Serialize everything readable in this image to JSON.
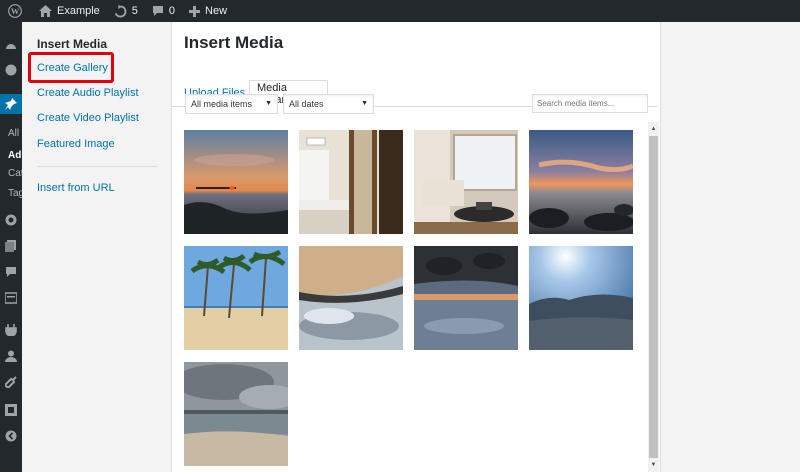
{
  "admin_bar": {
    "site_name": "Example",
    "updates_count": "5",
    "comments_count": "0",
    "new_label": "New"
  },
  "admin_menu": {
    "items": [
      "All",
      "Ad",
      "Cat",
      "Tag"
    ]
  },
  "media_menu": {
    "heading": "Insert Media",
    "items": [
      "Create Gallery",
      "Create Audio Playlist",
      "Create Video Playlist",
      "Featured Image"
    ],
    "insert_from_url": "Insert from URL"
  },
  "frame": {
    "title": "Insert Media",
    "tabs": [
      {
        "label": "Upload Files",
        "active": false
      },
      {
        "label": "Media Library",
        "active": true
      }
    ]
  },
  "toolbar": {
    "filter_type_selected": "All media items",
    "filter_date_selected": "All dates",
    "search_placeholder": "Search media items..."
  },
  "attachments": [
    {
      "icon": "sunset-pier-photo"
    },
    {
      "icon": "bedroom-photo"
    },
    {
      "icon": "living-room-photo"
    },
    {
      "icon": "sunset-rocks-photo"
    },
    {
      "icon": "palm-beach-photo"
    },
    {
      "icon": "sand-sky-photo"
    },
    {
      "icon": "dusk-sea-photo"
    },
    {
      "icon": "blue-sky-hills-photo"
    },
    {
      "icon": "cloudy-beach-photo"
    }
  ],
  "colors": {
    "accent": "#0073aa",
    "highlight_box": "#e3000f",
    "admin_bar": "#23282d"
  }
}
